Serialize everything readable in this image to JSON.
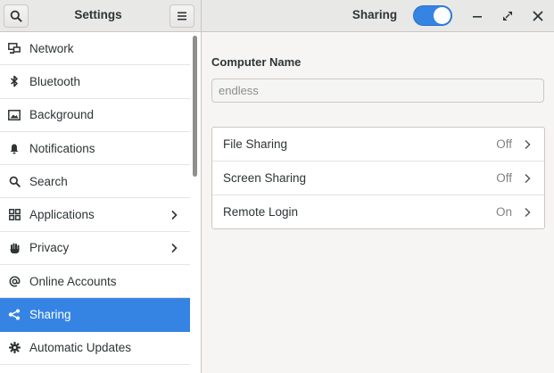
{
  "sidebar_title": "Settings",
  "page_title": "Sharing",
  "sharing_switch": "on",
  "sidebar": {
    "items": [
      {
        "label": "Network",
        "icon": "network-icon",
        "chevron": false,
        "selected": false
      },
      {
        "label": "Bluetooth",
        "icon": "bluetooth-icon",
        "chevron": false,
        "selected": false
      },
      {
        "label": "Background",
        "icon": "background-icon",
        "chevron": false,
        "selected": false
      },
      {
        "label": "Notifications",
        "icon": "bell-icon",
        "chevron": false,
        "selected": false
      },
      {
        "label": "Search",
        "icon": "search-icon",
        "chevron": false,
        "selected": false
      },
      {
        "label": "Applications",
        "icon": "applications-icon",
        "chevron": true,
        "selected": false
      },
      {
        "label": "Privacy",
        "icon": "hand-icon",
        "chevron": true,
        "selected": false
      },
      {
        "label": "Online Accounts",
        "icon": "at-icon",
        "chevron": false,
        "selected": false
      },
      {
        "label": "Sharing",
        "icon": "share-icon",
        "chevron": false,
        "selected": true
      },
      {
        "label": "Automatic Updates",
        "icon": "gear-icon",
        "chevron": false,
        "selected": false
      }
    ]
  },
  "main": {
    "computer_name_label": "Computer Name",
    "computer_name_placeholder": "endless",
    "rows": [
      {
        "label": "File Sharing",
        "status": "Off"
      },
      {
        "label": "Screen Sharing",
        "status": "Off"
      },
      {
        "label": "Remote Login",
        "status": "On"
      }
    ]
  },
  "colors": {
    "accent": "#3584e4",
    "sidebar_bg": "#ffffff",
    "window_bg": "#f6f5f4"
  }
}
